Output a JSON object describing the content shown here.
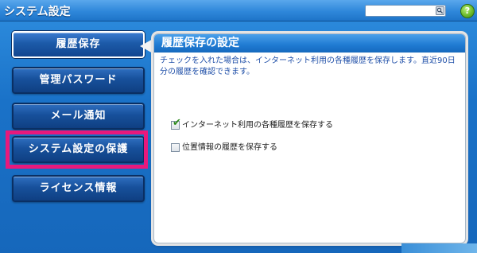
{
  "window": {
    "title": "システム設定"
  },
  "search": {
    "value": "",
    "placeholder": ""
  },
  "icons": {
    "search": "search-icon",
    "help": "help-icon"
  },
  "help_glyph": "?",
  "sidebar": {
    "items": [
      {
        "label": "履歴保存"
      },
      {
        "label": "管理パスワード"
      },
      {
        "label": "メール通知"
      },
      {
        "label": "システム設定の保護"
      },
      {
        "label": "ライセンス情報"
      }
    ]
  },
  "panel": {
    "title": "履歴保存の設定",
    "description": "チェックを入れた場合は、インターネット利用の各種履歴を保存します。直近90日分の履歴を確認できます。",
    "options": [
      {
        "label": "インターネット利用の各種履歴を保存する",
        "checked": true
      },
      {
        "label": "位置情報の履歴を保存する",
        "checked": false
      }
    ]
  },
  "colors": {
    "highlight": "#e8197c",
    "accent": "#1f7ad2"
  }
}
